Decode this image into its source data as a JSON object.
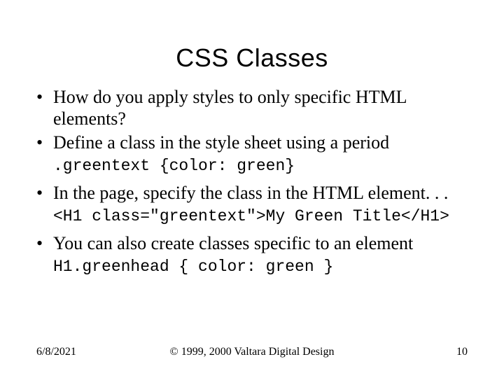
{
  "title": "CSS Classes",
  "bullets": {
    "b1": "How do you apply styles to only specific HTML elements?",
    "b2": "Define a class in the style sheet using a period",
    "code1": ".greentext {color: green}",
    "b3": "In the page, specify the class in the HTML element. . .",
    "code2": "<H1 class=\"greentext\">My Green Title</H1>",
    "b4": "You can also create classes specific to an element",
    "code3": "H1.greenhead { color: green }"
  },
  "footer": {
    "date": "6/8/2021",
    "copyright": "© 1999, 2000 Valtara Digital Design",
    "page": "10"
  }
}
